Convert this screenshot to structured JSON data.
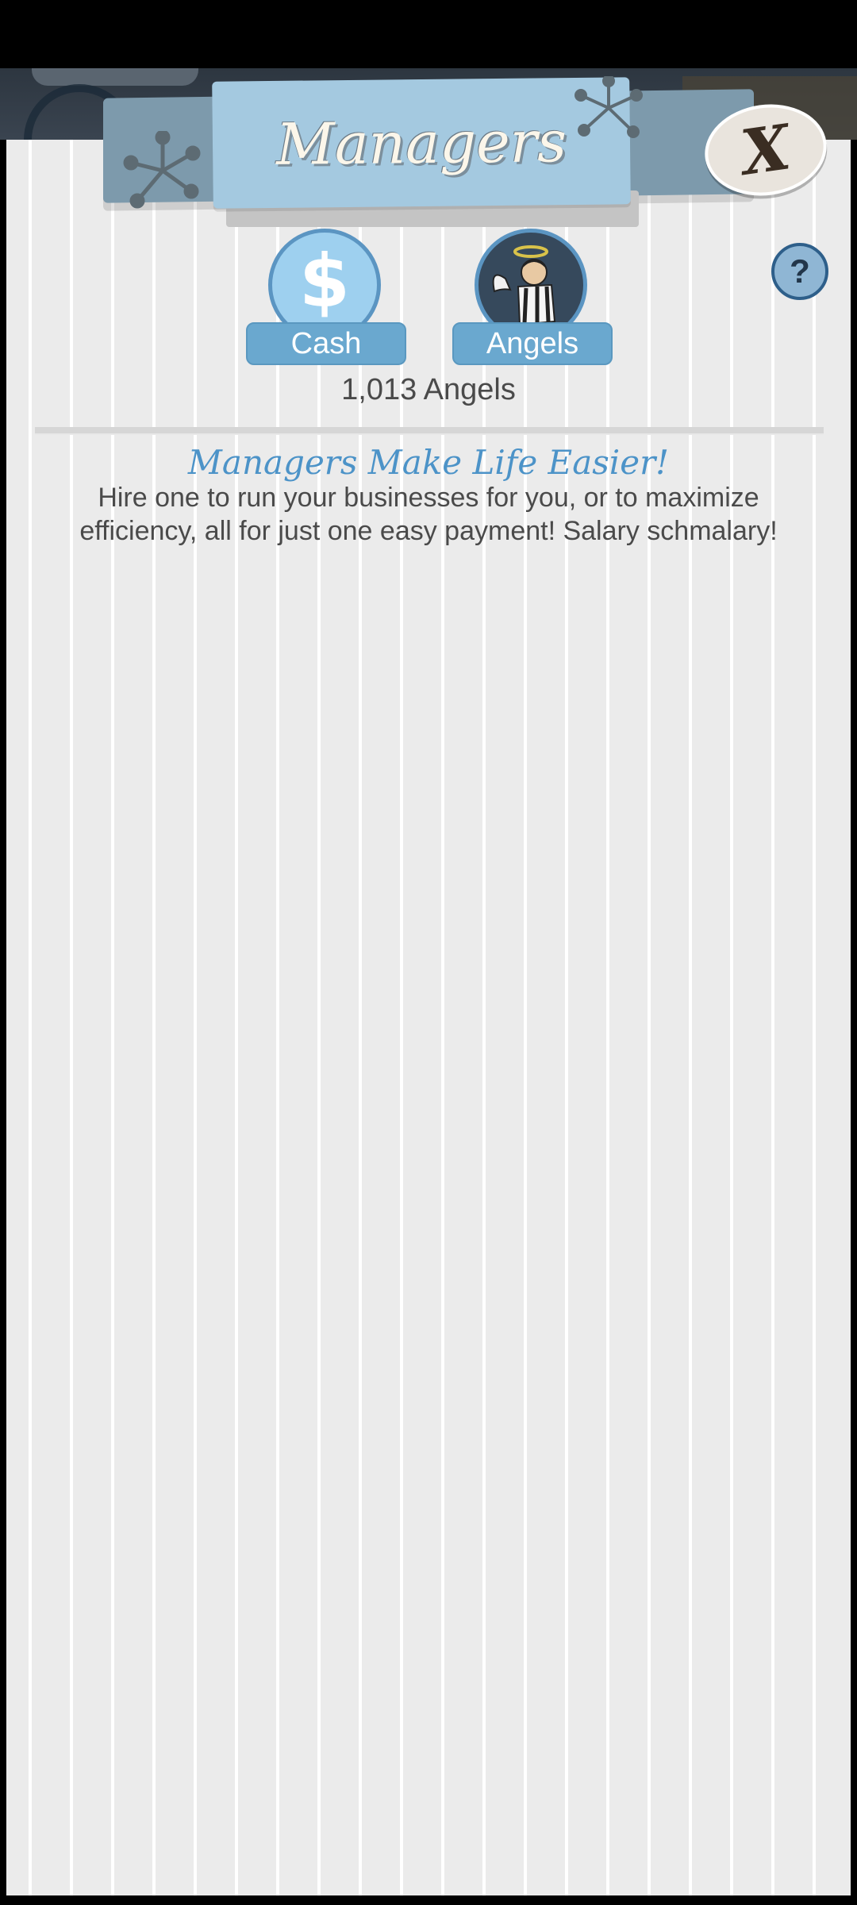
{
  "header": {
    "title": "Managers",
    "close_label": "X",
    "help_label": "?"
  },
  "tabs": [
    {
      "label": "Cash",
      "icon": "dollar-icon",
      "glyph": "$"
    },
    {
      "label": "Angels",
      "icon": "angel-investor-icon"
    }
  ],
  "angels_count": "1,013 Angels",
  "info": {
    "headline": "Managers Make Life Easier!",
    "body": "Hire one to run your businesses for you, or to maximize efficiency, all for just one easy payment! Salary schmalary!"
  },
  "colors": {
    "panel_bg": "#ebebeb",
    "banner": "#a4c9e0",
    "accent": "#4c93c8",
    "tab": "#6aa8cf"
  }
}
